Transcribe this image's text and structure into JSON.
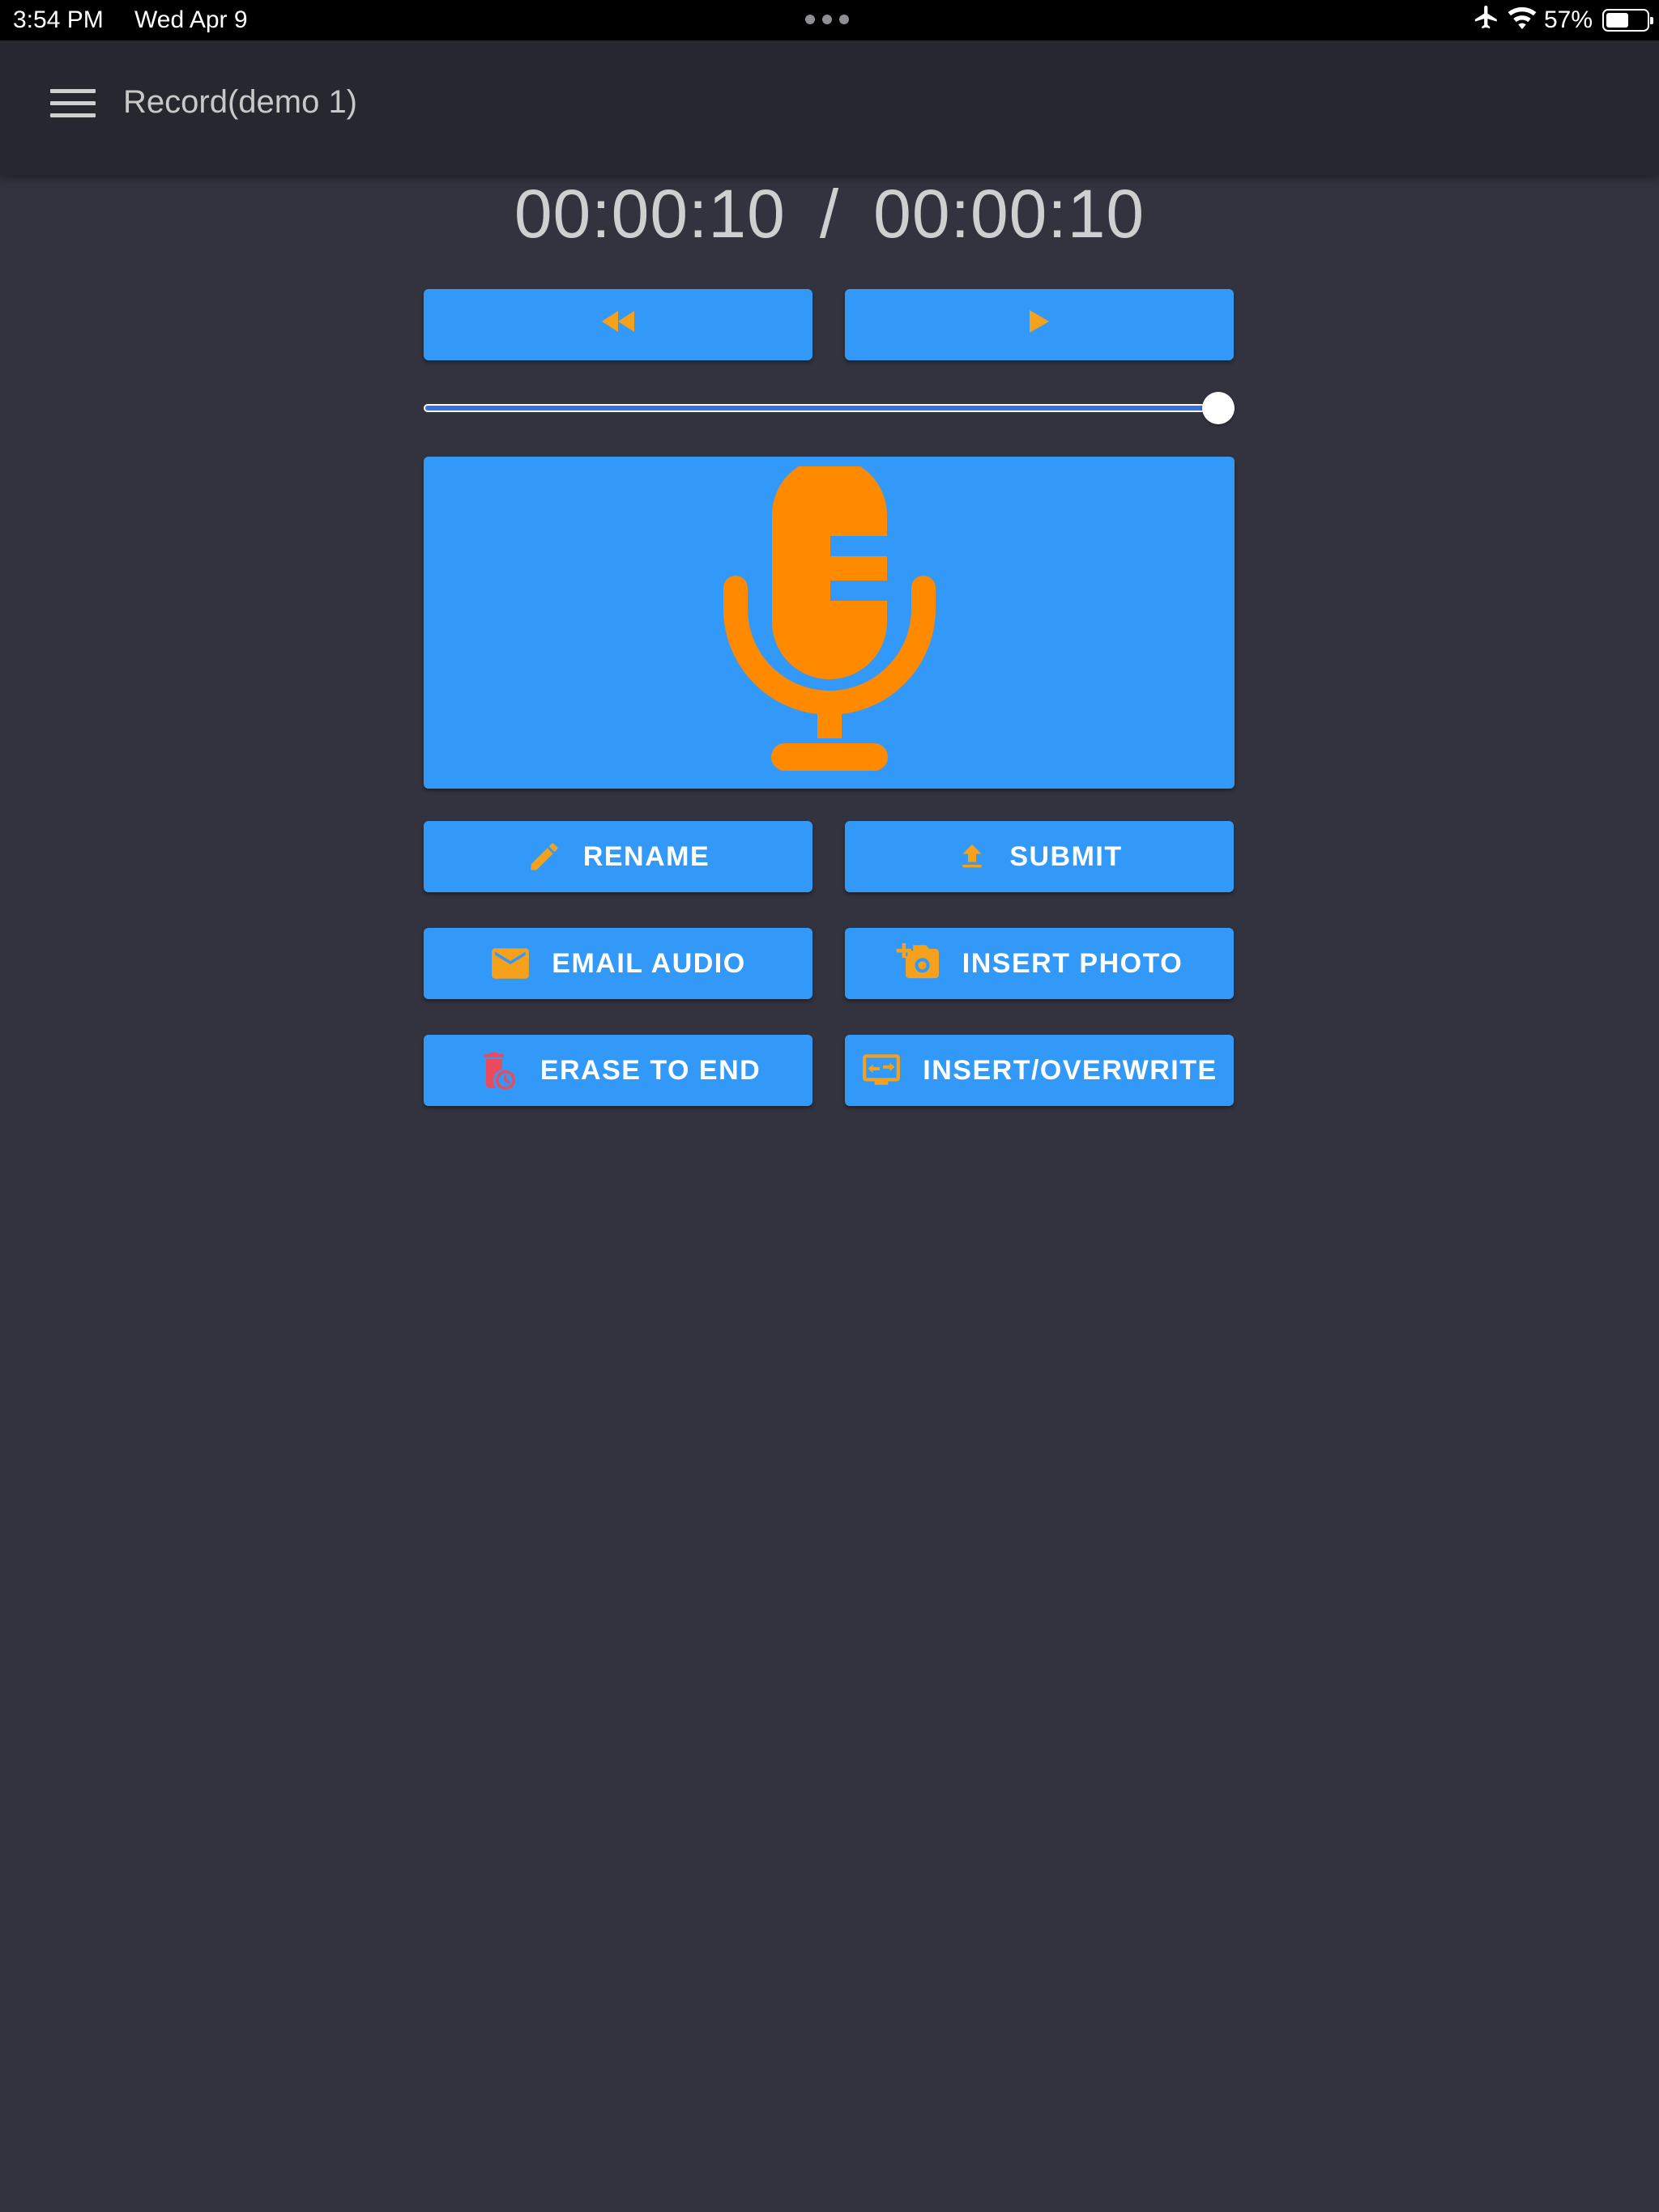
{
  "status_bar": {
    "time": "3:54 PM",
    "date": "Wed Apr 9",
    "battery": "57%",
    "battery_level": 0.57,
    "icons": [
      "airplane-icon",
      "wifi-icon",
      "battery-icon"
    ]
  },
  "app_bar": {
    "menu_icon": "hamburger-menu-icon",
    "title": "Record(demo 1)"
  },
  "timer": {
    "current": "00:00:10",
    "separator": "/",
    "total": "00:00:10"
  },
  "playback": {
    "rewind_icon": "rewind-icon",
    "play_icon": "play-icon",
    "progress": 1.0
  },
  "record": {
    "icon": "microphone-icon"
  },
  "actions": {
    "rename": "RENAME",
    "submit": "SUBMIT",
    "email_audio": "EMAIL AUDIO",
    "insert_photo": "INSERT PHOTO",
    "erase_to_end": "ERASE TO END",
    "insert_overwrite": "INSERT/OVERWRITE"
  },
  "colors": {
    "background": "#33333f",
    "app_bar": "#272730",
    "button": "#3399f9",
    "icon_accent": "#f5a11c",
    "mic": "#ff8a00",
    "erase_icon": "#e84c5c",
    "slider_fill": "#3b6fe0"
  }
}
